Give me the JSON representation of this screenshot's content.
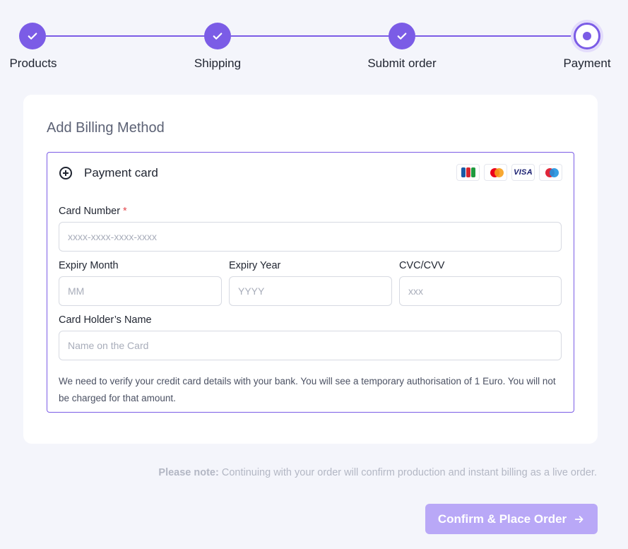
{
  "stepper": {
    "steps": [
      {
        "label": "Products",
        "state": "complete"
      },
      {
        "label": "Shipping",
        "state": "complete"
      },
      {
        "label": "Submit order",
        "state": "complete"
      },
      {
        "label": "Payment",
        "state": "current"
      }
    ]
  },
  "billing": {
    "title": "Add Billing Method",
    "method_title": "Payment card",
    "method_icon": "plus-circle-icon",
    "card_brands": [
      "JCB",
      "Mastercard",
      "VISA",
      "Maestro"
    ],
    "visa_text": "VISA",
    "card_number": {
      "label": "Card Number",
      "required_mark": "*",
      "placeholder": "xxxx-xxxx-xxxx-xxxx",
      "value": ""
    },
    "expiry_month": {
      "label": "Expiry Month",
      "placeholder": "MM",
      "value": ""
    },
    "expiry_year": {
      "label": "Expiry Year",
      "placeholder": "YYYY",
      "value": ""
    },
    "cvc": {
      "label": "CVC/CVV",
      "placeholder": "xxx",
      "value": ""
    },
    "holder": {
      "label": "Card Holder’s Name",
      "placeholder": "Name on the Card",
      "value": ""
    },
    "help_text": "We need to verify your credit card details with your bank. You will see a temporary authorisation of 1 Euro. You will not be charged for that amount."
  },
  "footer": {
    "note_prefix": "Please note:",
    "note_text": " Continuing with your order will confirm production and instant billing as a live order.",
    "confirm_label": "Confirm & Place Order",
    "confirm_icon": "arrow-right-icon"
  },
  "colors": {
    "accent": "#7b5ce6",
    "button_disabled": "#b9a8f7",
    "background": "#f4f5fb",
    "required": "#e5484d"
  }
}
